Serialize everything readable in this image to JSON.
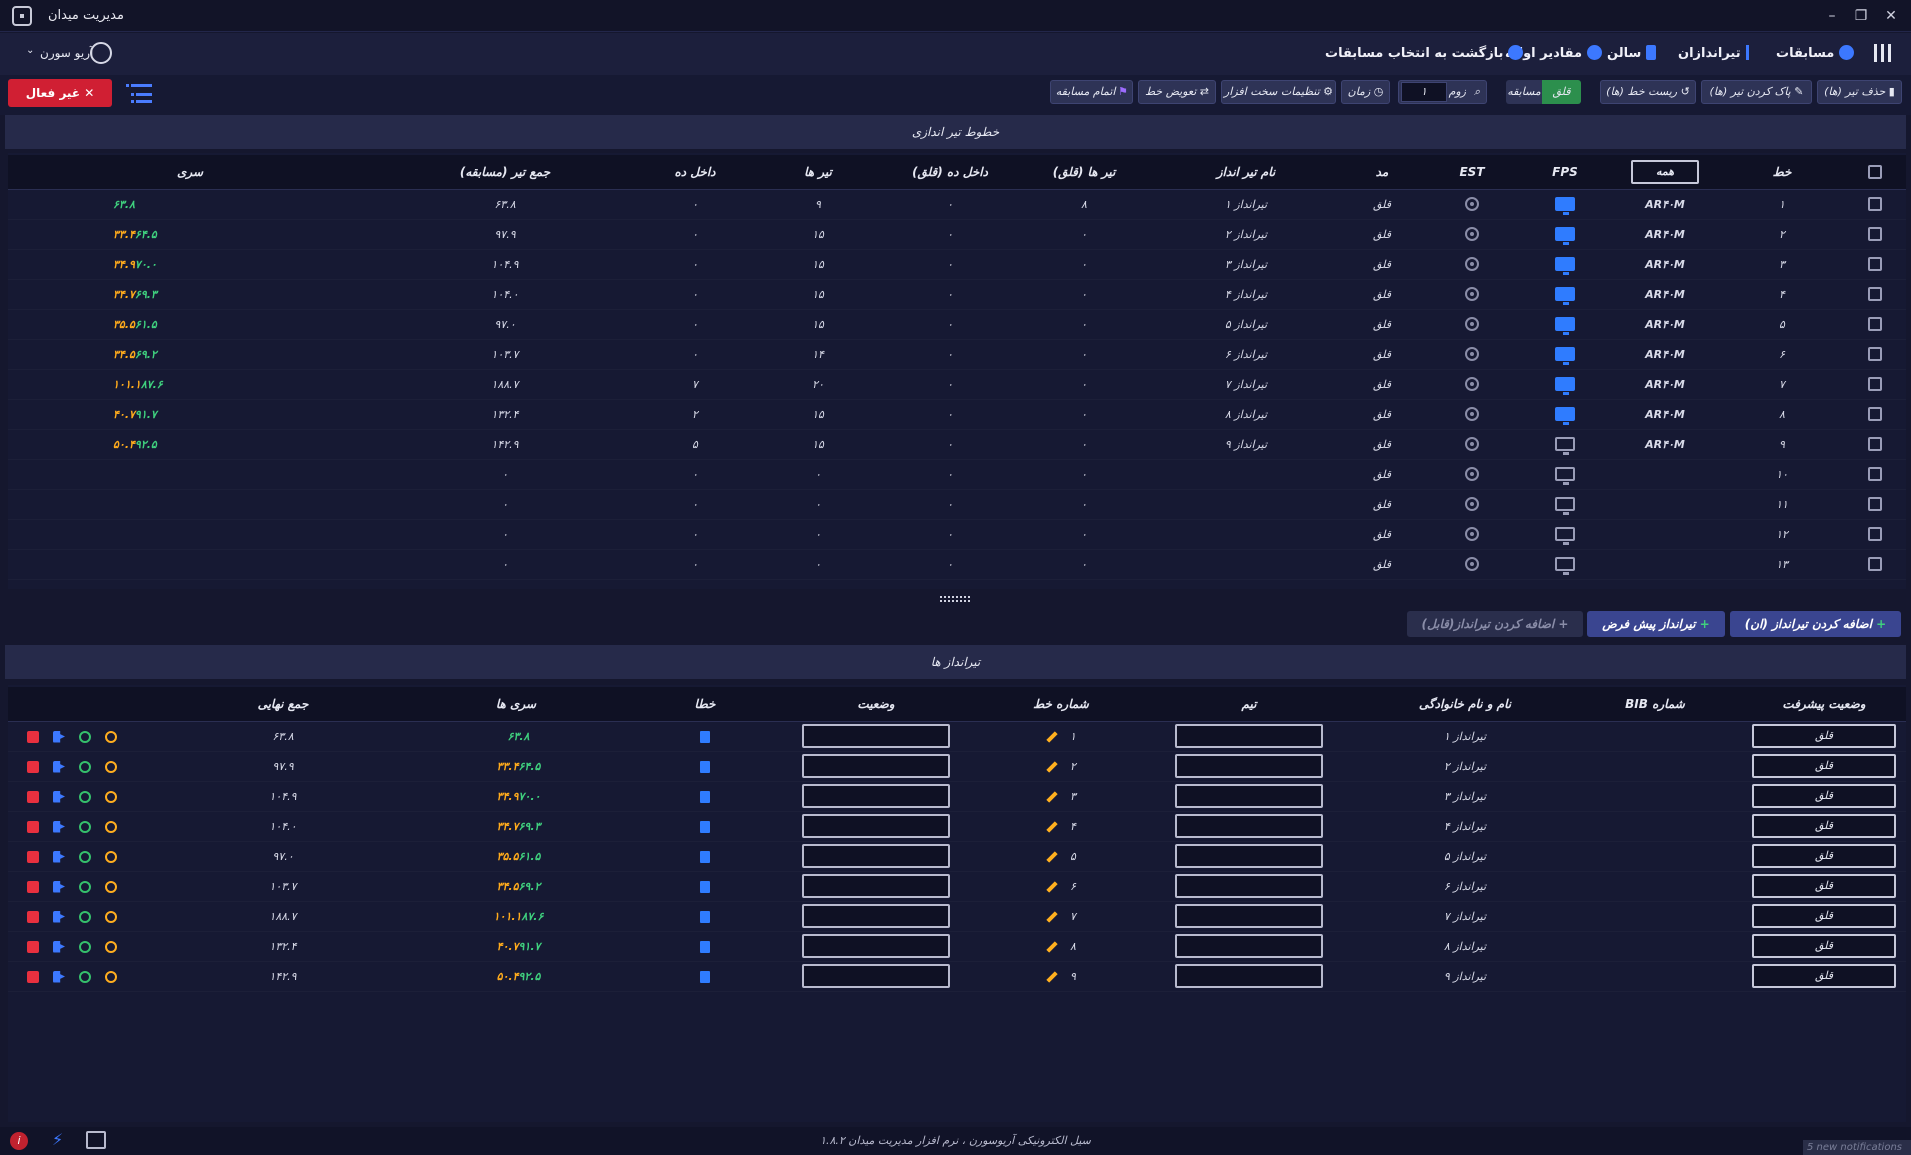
{
  "window": {
    "title": "مدیریت میدان",
    "minimize": "–",
    "restore": "❐",
    "close": "✕"
  },
  "nav": {
    "competitions": "مسابقات",
    "shooters": "تیراندازان",
    "hall": "سالن",
    "initial_values": "مقادیر اولیه",
    "back": "بازگشت به انتخاب مسابقات"
  },
  "user": {
    "name": "آریو سورن"
  },
  "toolbar": {
    "inactive": "غیر فعال",
    "delete_shot": "حذف تیر (ها)",
    "clear_shot": "پاک کردن تیر (ها)",
    "reset_line": "ریست خط (ها)",
    "mode_practice": "قلق",
    "mode_match": "مسابقه",
    "zoom_label": "زوم",
    "zoom_value": "۱",
    "time": "زمان",
    "hardware": "تنظیمات سخت افزار",
    "swap_line": "تعویض خط",
    "end_match": "اتمام مسابقه"
  },
  "lines_section": {
    "title": "خطوط تیر اندازی",
    "headers": {
      "line": "خط",
      "all_button": "همه",
      "fps": "FPS",
      "est": "EST",
      "mode": "مد",
      "shooter_name": "نام تیر انداز",
      "shots_practice": "تیر ها (قلق)",
      "inner_ten_practice": "داخل ده (قلق)",
      "shots": "تیر ها",
      "inner_ten": "داخل ده",
      "total": "جمع تیر (مسابقه)",
      "series": "سری"
    },
    "rows": [
      {
        "line": "۱",
        "weapon": "AR۴۰M",
        "fps_on": true,
        "mode": "قلق",
        "name": "تیرانداز ۱",
        "shots_practice": "۸",
        "inner_practice": "۰",
        "shots": "۹",
        "inner": "۰",
        "total": "۶۳.۸",
        "s1": "۶۳.۸",
        "s2": ""
      },
      {
        "line": "۲",
        "weapon": "AR۴۰M",
        "fps_on": true,
        "mode": "قلق",
        "name": "تیرانداز ۲",
        "shots_practice": "۰",
        "inner_practice": "۰",
        "shots": "۱۵",
        "inner": "۰",
        "total": "۹۷.۹",
        "s1": "۶۴.۵",
        "s2": "۳۳.۴"
      },
      {
        "line": "۳",
        "weapon": "AR۴۰M",
        "fps_on": true,
        "mode": "قلق",
        "name": "تیرانداز ۳",
        "shots_practice": "۰",
        "inner_practice": "۰",
        "shots": "۱۵",
        "inner": "۰",
        "total": "۱۰۴.۹",
        "s1": "۷۰.۰",
        "s2": "۳۴.۹"
      },
      {
        "line": "۴",
        "weapon": "AR۴۰M",
        "fps_on": true,
        "mode": "قلق",
        "name": "تیرانداز ۴",
        "shots_practice": "۰",
        "inner_practice": "۰",
        "shots": "۱۵",
        "inner": "۰",
        "total": "۱۰۴.۰",
        "s1": "۶۹.۳",
        "s2": "۳۴.۷"
      },
      {
        "line": "۵",
        "weapon": "AR۴۰M",
        "fps_on": true,
        "mode": "قلق",
        "name": "تیرانداز ۵",
        "shots_practice": "۰",
        "inner_practice": "۰",
        "shots": "۱۵",
        "inner": "۰",
        "total": "۹۷.۰",
        "s1": "۶۱.۵",
        "s2": "۳۵.۵"
      },
      {
        "line": "۶",
        "weapon": "AR۴۰M",
        "fps_on": true,
        "mode": "قلق",
        "name": "تیرانداز ۶",
        "shots_practice": "۰",
        "inner_practice": "۰",
        "shots": "۱۴",
        "inner": "۰",
        "total": "۱۰۳.۷",
        "s1": "۶۹.۲",
        "s2": "۳۴.۵"
      },
      {
        "line": "۷",
        "weapon": "AR۴۰M",
        "fps_on": true,
        "mode": "قلق",
        "name": "تیرانداز ۷",
        "shots_practice": "۰",
        "inner_practice": "۰",
        "shots": "۲۰",
        "inner": "۷",
        "total": "۱۸۸.۷",
        "s1": "۸۷.۶",
        "s2": "۱۰۱.۱"
      },
      {
        "line": "۸",
        "weapon": "AR۴۰M",
        "fps_on": true,
        "mode": "قلق",
        "name": "تیرانداز ۸",
        "shots_practice": "۰",
        "inner_practice": "۰",
        "shots": "۱۵",
        "inner": "۲",
        "total": "۱۳۲.۴",
        "s1": "۹۱.۷",
        "s2": "۴۰.۷"
      },
      {
        "line": "۹",
        "weapon": "AR۴۰M",
        "fps_on": false,
        "mode": "قلق",
        "name": "تیرانداز ۹",
        "shots_practice": "۰",
        "inner_practice": "۰",
        "shots": "۱۵",
        "inner": "۵",
        "total": "۱۴۲.۹",
        "s1": "۹۲.۵",
        "s2": "۵۰.۴"
      },
      {
        "line": "۱۰",
        "weapon": "",
        "fps_on": false,
        "mode": "قلق",
        "name": "",
        "shots_practice": "۰",
        "inner_practice": "۰",
        "shots": "۰",
        "inner": "۰",
        "total": "۰",
        "s1": "",
        "s2": ""
      },
      {
        "line": "۱۱",
        "weapon": "",
        "fps_on": false,
        "mode": "قلق",
        "name": "",
        "shots_practice": "۰",
        "inner_practice": "۰",
        "shots": "۰",
        "inner": "۰",
        "total": "۰",
        "s1": "",
        "s2": ""
      },
      {
        "line": "۱۲",
        "weapon": "",
        "fps_on": false,
        "mode": "قلق",
        "name": "",
        "shots_practice": "۰",
        "inner_practice": "۰",
        "shots": "۰",
        "inner": "۰",
        "total": "۰",
        "s1": "",
        "s2": ""
      },
      {
        "line": "۱۳",
        "weapon": "",
        "fps_on": false,
        "mode": "قلق",
        "name": "",
        "shots_practice": "۰",
        "inner_practice": "۰",
        "shots": "۰",
        "inner": "۰",
        "total": "۰",
        "s1": "",
        "s2": ""
      }
    ]
  },
  "add_buttons": {
    "add_shooter_on": "اضافه کردن تیرانداز (ان)",
    "default_shooter": "تیرانداز پیش فرض",
    "add_shooter_capable": "اضافه کردن تیرانداز(قابل)"
  },
  "shooters_section": {
    "title": "تیرانداز ها",
    "headers": {
      "progress": "وضعیت پیشرفت",
      "bib": "شماره BIB",
      "name": "نام و نام خانوادگی",
      "team": "تیم",
      "line_no": "شماره خط",
      "status": "وضعیت",
      "error": "خطا",
      "series": "سری ها",
      "final_total": "جمع نهایی"
    },
    "rows": [
      {
        "progress": "قلق",
        "name": "تیرانداز ۱",
        "line": "۱",
        "s1": "۶۳.۸",
        "s2": "",
        "final": "۶۳.۸"
      },
      {
        "progress": "قلق",
        "name": "تیرانداز ۲",
        "line": "۲",
        "s1": "۶۴.۵",
        "s2": "۳۳.۴",
        "final": "۹۷.۹"
      },
      {
        "progress": "قلق",
        "name": "تیرانداز ۳",
        "line": "۳",
        "s1": "۷۰.۰",
        "s2": "۳۴.۹",
        "final": "۱۰۴.۹"
      },
      {
        "progress": "قلق",
        "name": "تیرانداز ۴",
        "line": "۴",
        "s1": "۶۹.۳",
        "s2": "۳۴.۷",
        "final": "۱۰۴.۰"
      },
      {
        "progress": "قلق",
        "name": "تیرانداز ۵",
        "line": "۵",
        "s1": "۶۱.۵",
        "s2": "۳۵.۵",
        "final": "۹۷.۰"
      },
      {
        "progress": "قلق",
        "name": "تیرانداز ۶",
        "line": "۶",
        "s1": "۶۹.۲",
        "s2": "۳۴.۵",
        "final": "۱۰۳.۷"
      },
      {
        "progress": "قلق",
        "name": "تیرانداز ۷",
        "line": "۷",
        "s1": "۸۷.۶",
        "s2": "۱۰۱.۱",
        "final": "۱۸۸.۷"
      },
      {
        "progress": "قلق",
        "name": "تیرانداز ۸",
        "line": "۸",
        "s1": "۹۱.۷",
        "s2": "۴۰.۷",
        "final": "۱۳۲.۴"
      },
      {
        "progress": "قلق",
        "name": "تیرانداز ۹",
        "line": "۹",
        "s1": "۹۲.۵",
        "s2": "۵۰.۴",
        "final": "۱۴۲.۹"
      }
    ]
  },
  "footer": {
    "text": "سیل الکترونیکی آریوسورن ، نرم افزار مدیریت میدان ۱.۸.۲",
    "notifications": "5 new notifications"
  },
  "colors": {
    "accent": "#2f7cff",
    "danger": "#d01f33",
    "weapon": "#ff9d16",
    "series_green": "#3fd07e",
    "series_gold": "#ffab1c"
  }
}
